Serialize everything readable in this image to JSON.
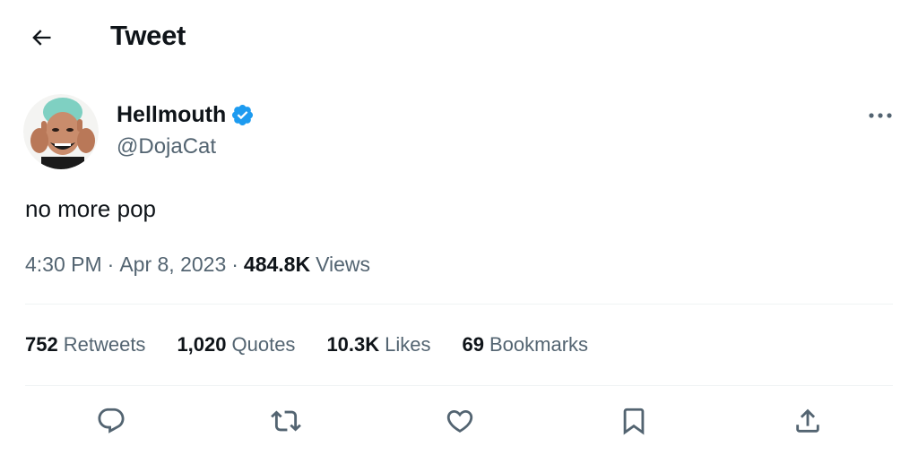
{
  "header": {
    "title": "Tweet",
    "back_icon": "arrow-left-icon"
  },
  "author": {
    "display_name": "Hellmouth",
    "handle": "@DojaCat",
    "verified": true,
    "badge_color": "#1d9bf0"
  },
  "tweet": {
    "text": "no more pop",
    "time": "4:30 PM",
    "date": "Apr 8, 2023",
    "views_count": "484.8K",
    "views_label": "Views"
  },
  "stats": [
    {
      "count": "752",
      "label": "Retweets"
    },
    {
      "count": "1,020",
      "label": "Quotes"
    },
    {
      "count": "10.3K",
      "label": "Likes"
    },
    {
      "count": "69",
      "label": "Bookmarks"
    }
  ],
  "actions": [
    {
      "name": "reply",
      "icon": "reply-icon"
    },
    {
      "name": "retweet",
      "icon": "retweet-icon"
    },
    {
      "name": "like",
      "icon": "heart-icon"
    },
    {
      "name": "bookmark",
      "icon": "bookmark-icon"
    },
    {
      "name": "share",
      "icon": "share-icon"
    }
  ],
  "colors": {
    "primary_text": "#0f1419",
    "secondary_text": "#536471",
    "divider": "#eff3f4",
    "verified": "#1d9bf0"
  }
}
